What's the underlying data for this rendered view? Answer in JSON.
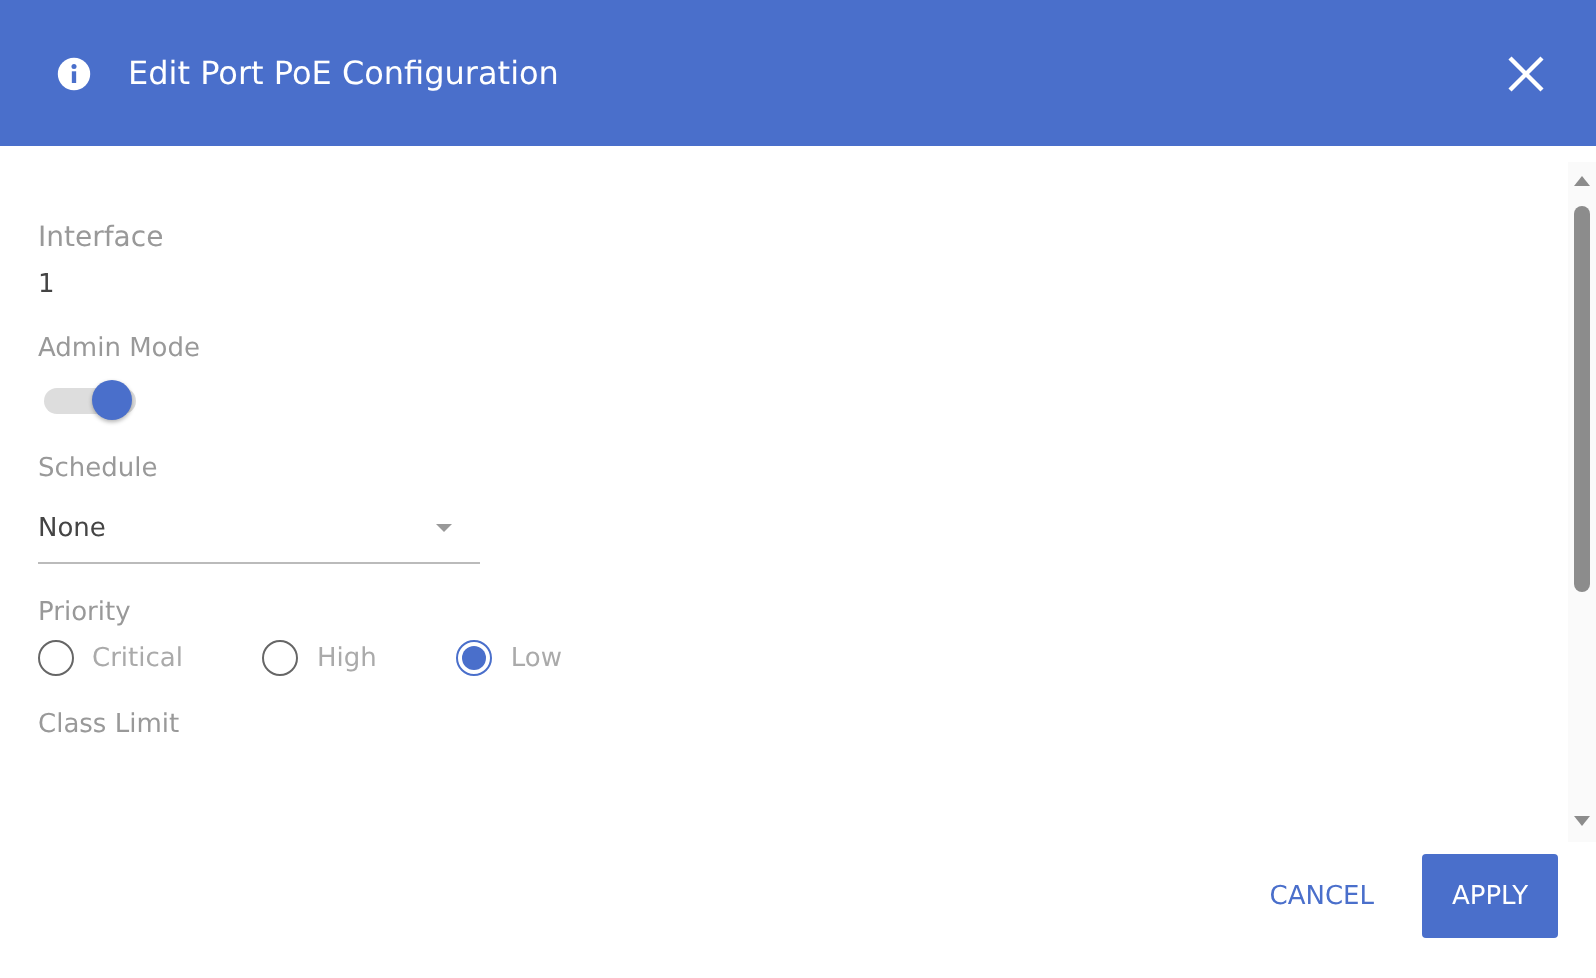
{
  "dialog": {
    "title": "Edit Port PoE Configuration"
  },
  "fields": [
    {
      "kind": "text",
      "label": "Interface",
      "value": "1"
    },
    {
      "kind": "toggle",
      "label": "Admin Mode",
      "on": true
    },
    {
      "kind": "select",
      "label": "Schedule",
      "value": "None"
    },
    {
      "kind": "radio",
      "label": "Priority",
      "options": [
        {
          "label": "Critical",
          "selected": false
        },
        {
          "label": "High",
          "selected": false
        },
        {
          "label": "Low",
          "selected": true
        }
      ]
    },
    {
      "kind": "heading",
      "label": "Class Limit"
    }
  ],
  "buttons": [
    {
      "kind": "text",
      "label": "CANCEL"
    },
    {
      "kind": "primary",
      "label": "APPLY"
    }
  ]
}
